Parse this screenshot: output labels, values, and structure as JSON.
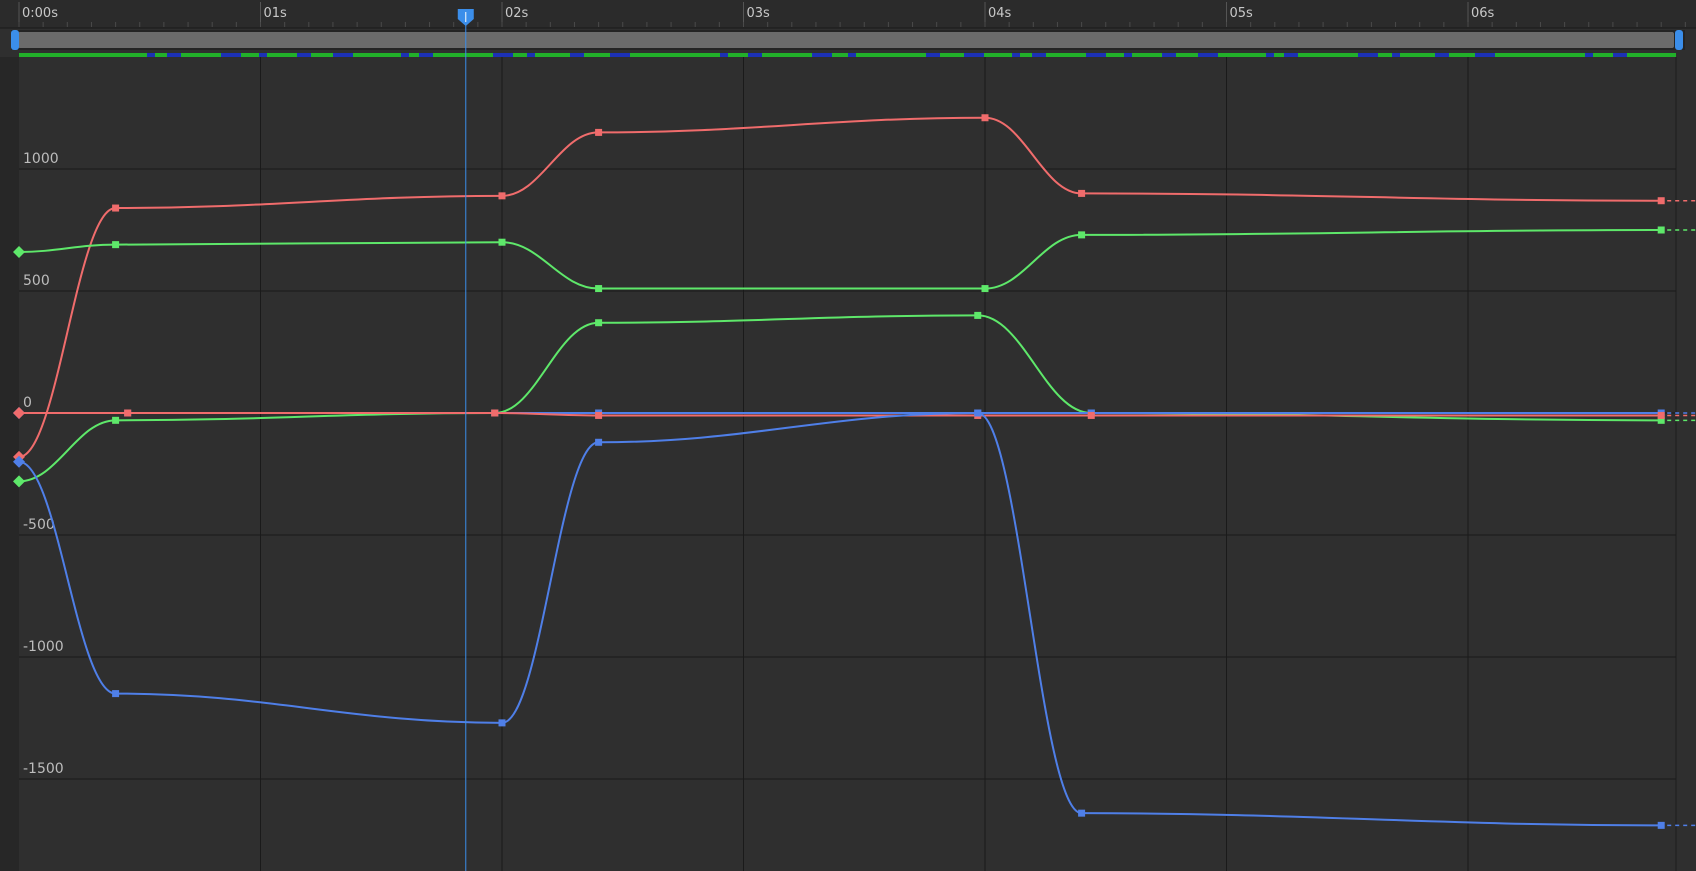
{
  "timeline": {
    "time_ticks": [
      {
        "t": 0,
        "label": "0:00s"
      },
      {
        "t": 1,
        "label": "01s"
      },
      {
        "t": 2,
        "label": "02s"
      },
      {
        "t": 3,
        "label": "03s"
      },
      {
        "t": 4,
        "label": "04s"
      },
      {
        "t": 5,
        "label": "05s"
      },
      {
        "t": 6,
        "label": "06s"
      }
    ],
    "playhead_time": 1.85,
    "range": {
      "start": 0,
      "end": 6.95
    }
  },
  "value_axis": {
    "ticks": [
      {
        "v": 1000,
        "label": "1000"
      },
      {
        "v": 500,
        "label": "500"
      },
      {
        "v": 0,
        "label": "0"
      },
      {
        "v": -500,
        "label": "-500"
      },
      {
        "v": -1000,
        "label": "-1000"
      },
      {
        "v": -1500,
        "label": "-1500"
      }
    ],
    "range": [
      -1880,
      1350
    ]
  },
  "colors": {
    "background": "#2f2f2f",
    "gutter": "#252525",
    "grid": "#1a1a1a",
    "accent": "#3b8eea",
    "scrollbar": "#6b6b6b",
    "summary_green": "#22b02a",
    "summary_blue": "#1c31b5"
  },
  "chart_data": {
    "type": "line",
    "curve_mode": "smooth-bezier",
    "x_unit": "s",
    "series": [
      {
        "color": "#f06c6c",
        "keys": [
          [
            0,
            -180
          ],
          [
            0.4,
            840
          ],
          [
            2.0,
            890
          ],
          [
            2.4,
            1150
          ],
          [
            4.0,
            1210
          ],
          [
            4.4,
            900
          ],
          [
            6.8,
            870
          ]
        ]
      },
      {
        "color": "#5ee86a",
        "keys": [
          [
            0,
            660
          ],
          [
            0.4,
            690
          ],
          [
            2.0,
            700
          ],
          [
            2.4,
            510
          ],
          [
            4.0,
            510
          ],
          [
            4.4,
            730
          ],
          [
            6.8,
            750
          ]
        ]
      },
      {
        "color": "#5ee86a",
        "keys": [
          [
            0,
            -280
          ],
          [
            0.4,
            -30
          ],
          [
            1.97,
            0
          ],
          [
            2.4,
            370
          ],
          [
            3.97,
            400
          ],
          [
            4.44,
            0
          ],
          [
            6.8,
            -30
          ]
        ]
      },
      {
        "color": "#4f7fe8",
        "keys": [
          [
            0,
            0
          ],
          [
            0.45,
            0
          ],
          [
            1.97,
            0
          ],
          [
            2.4,
            0
          ],
          [
            3.97,
            0
          ],
          [
            4.44,
            0
          ],
          [
            6.8,
            0
          ]
        ]
      },
      {
        "color": "#f06c6c",
        "keys": [
          [
            0,
            0
          ],
          [
            0.45,
            0
          ],
          [
            1.97,
            0
          ],
          [
            2.4,
            -10
          ],
          [
            3.97,
            -10
          ],
          [
            4.44,
            -10
          ],
          [
            6.8,
            -10
          ]
        ]
      },
      {
        "color": "#4f7fe8",
        "keys": [
          [
            0,
            -200
          ],
          [
            0.4,
            -1150
          ],
          [
            2.0,
            -1270
          ],
          [
            2.4,
            -120
          ],
          [
            3.97,
            0
          ],
          [
            4.4,
            -1640
          ],
          [
            6.8,
            -1690
          ]
        ]
      }
    ]
  }
}
